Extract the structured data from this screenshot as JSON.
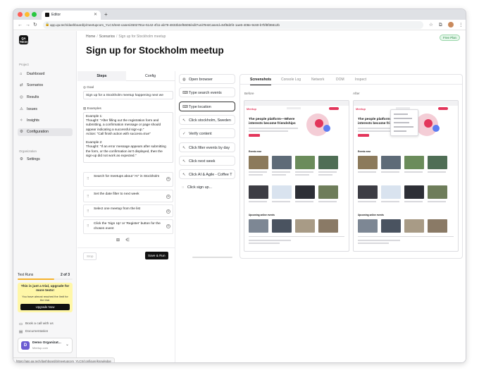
{
  "browser": {
    "tab_title": "Editor",
    "url": "app.qa.tech/dashboard/p/meetupcom_YLCS/test-cases/4502781e-5142-4f11-ab79-4833b2ef6606/edit?unitTestCaseId=84f8d2f4-1ae6-408e-9c60-b7bf8f36612b",
    "status_url": "https://app.qa.tech/dashboard/p/meetupcom_YLCS/configure/knowledge",
    "colors": {
      "close": "#ff5f57",
      "min": "#febc2e",
      "max": "#28c840"
    }
  },
  "sidebar": {
    "logo": "QA\nTECH",
    "section_project": "Project",
    "items": [
      {
        "label": "Dashboard",
        "icon": "home-icon"
      },
      {
        "label": "Scenarios",
        "icon": "scenarios-icon"
      },
      {
        "label": "Results",
        "icon": "results-icon"
      },
      {
        "label": "Issues",
        "icon": "issues-icon"
      },
      {
        "label": "Insights",
        "icon": "insights-icon"
      },
      {
        "label": "Configuration",
        "icon": "configuration-icon"
      }
    ],
    "section_org": "Organization",
    "settings": "Settings",
    "trial": {
      "label": "Test Runs",
      "count": "2 of 3",
      "progress": 0.67,
      "title": "This is just a trial, upgrade for more tests!",
      "subtitle": "You have almost reached the limit for the trial.",
      "button": "Upgrade Now"
    },
    "book_call": "Book a call with us",
    "documentation": "Documentation",
    "org_initial": "D",
    "org_name": "Demo Organizat...",
    "org_sub": "Meetup.com",
    "collapse": "Collapse Sidebar"
  },
  "header": {
    "crumb_home": "Home",
    "crumb_scenarios": "Scenarios",
    "crumb_current": "Sign up for Stockholm meetup",
    "plan_badge": "Free Plan",
    "title": "Sign up for Stockholm meetup"
  },
  "editor": {
    "tab_steps": "Steps",
    "tab_config": "Config",
    "goal_label": "Goal",
    "goal_value": "Sign up for a Stockholm meetup happening next we",
    "examples_label": "Examples",
    "examples_text": "Example 1:\nThought: \"After filling out the registration form and submitting, a confirmation message or page should appear indicating a successful sign-up.\"\nAction: \"Call finish action with success=true\"\n\nExample 2:\nThought: \"If an error message appears after submitting the form, or the confirmation isn't displayed, then the sign-up did not work as expected.\"",
    "steps": [
      "Search for meetups about \"AI\" in Stockholm",
      "Set the date filter to next week",
      "Select one meetup from the list",
      "Click the 'Sign Up' or 'Register' button for the chosen event"
    ],
    "stop_button": "Stop",
    "save_button": "Save & Run"
  },
  "actions": [
    {
      "label": "Open browser",
      "icon": "globe-icon",
      "style": "normal"
    },
    {
      "label": "Type search events",
      "icon": "keyboard-icon",
      "style": "normal"
    },
    {
      "label": "Type location",
      "icon": "keyboard-icon",
      "style": "active"
    },
    {
      "label": "Click stockholm, Sweden",
      "icon": "cursor-icon",
      "style": "normal"
    },
    {
      "label": "Verify content",
      "icon": "check-icon",
      "style": "normal"
    },
    {
      "label": "Click filter events by day",
      "icon": "cursor-icon",
      "style": "normal"
    },
    {
      "label": "Click next week",
      "icon": "cursor-icon",
      "style": "normal"
    },
    {
      "label": "Click AI & Agile - Coffee T",
      "icon": "cursor-icon",
      "style": "normal"
    },
    {
      "label": "Click sign up...",
      "icon": "spinner-icon",
      "style": "plain"
    }
  ],
  "preview": {
    "tabs": [
      "Screenshots",
      "Console Log",
      "Network",
      "DOM",
      "Inspect"
    ],
    "before_label": "Before",
    "after_label": "After",
    "site_logo": "Meetup",
    "hero_text": "The people platform—Where interests become friendships",
    "section_events": "Events near",
    "section_upcoming": "Upcoming online events"
  }
}
